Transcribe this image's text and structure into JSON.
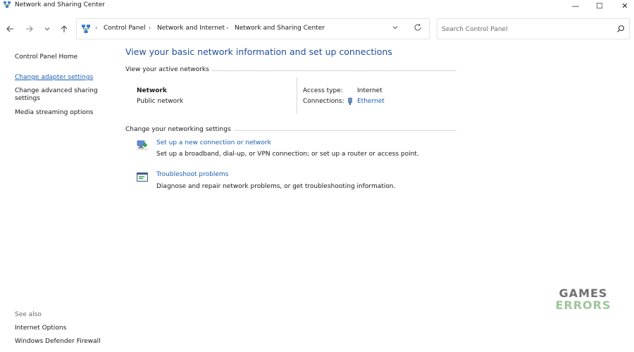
{
  "window": {
    "title": "Network and Sharing Center",
    "controls": {
      "minimize": "—",
      "maximize": "☐",
      "close": "✕"
    }
  },
  "navigation": {
    "back_icon": "arrow-left-icon",
    "forward_icon": "arrow-right-icon",
    "recent_icon": "chevron-down-icon",
    "up_icon": "arrow-up-icon",
    "breadcrumbs": [
      "Control Panel",
      "Network and Internet",
      "Network and Sharing Center"
    ],
    "search_placeholder": "Search Control Panel"
  },
  "sidebar": {
    "home": "Control Panel Home",
    "items": [
      "Change adapter settings",
      "Change advanced sharing settings",
      "Media streaming options"
    ],
    "see_also_heading": "See also",
    "see_also": [
      "Internet Options",
      "Windows Defender Firewall"
    ]
  },
  "main": {
    "title": "View your basic network information and set up connections",
    "active_networks_heading": "View your active networks",
    "network": {
      "name": "Network",
      "type": "Public network",
      "access_type_label": "Access type:",
      "access_type_value": "Internet",
      "connections_label": "Connections:",
      "connections_value": "Ethernet"
    },
    "settings_heading": "Change your networking settings",
    "tasks": [
      {
        "icon": "new-connection-icon",
        "link": "Set up a new connection or network",
        "desc": "Set up a broadband, dial-up, or VPN connection; or set up a router or access point."
      },
      {
        "icon": "troubleshoot-icon",
        "link": "Troubleshoot problems",
        "desc": "Diagnose and repair network problems, or get troubleshooting information."
      }
    ]
  },
  "watermark": {
    "line1": "GAMES",
    "line2": "ERRORS"
  },
  "colors": {
    "link": "#1a5fb4",
    "title": "#1f4e99",
    "watermark_green": "#9cc79a"
  }
}
